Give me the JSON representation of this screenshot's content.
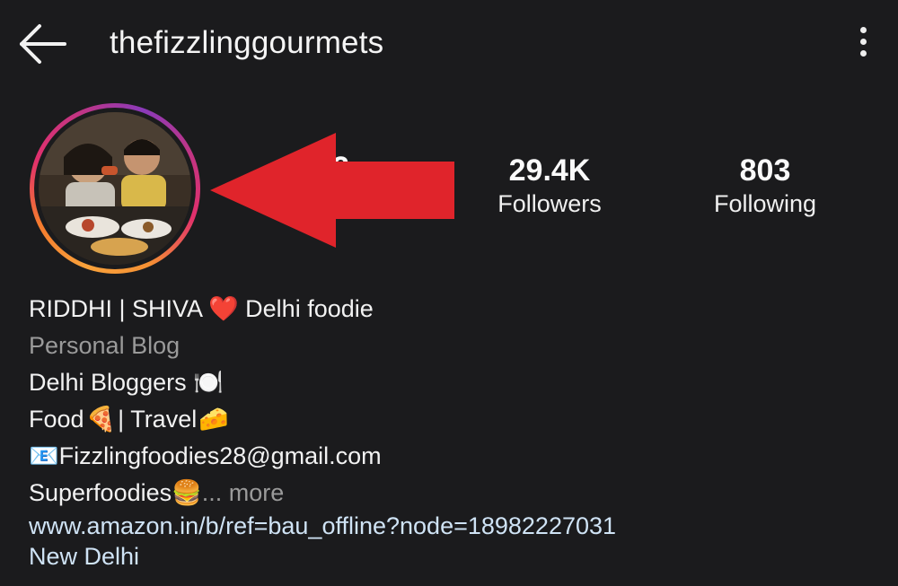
{
  "header": {
    "username": "thefizzlinggourmets"
  },
  "profile": {
    "posts_partial": "2",
    "stats": {
      "followers_count": "29.4K",
      "followers_label": "Followers",
      "following_count": "803",
      "following_label": "Following"
    },
    "bio": {
      "name_line": "RIDDHI | SHIVA ❤️ Delhi foodie",
      "category": "Personal Blog",
      "line1": "Delhi Bloggers 🍽️",
      "line2_a": "Food ",
      "line2_b": "🍕",
      "line2_c": "| Travel ",
      "line2_d": "🧀",
      "email": "📧Fizzlingfoodies28@gmail.com",
      "line4": "Superfoodies🍔",
      "more": "... more",
      "website": "www.amazon.in/b/ref=bau_offline?node=18982227031",
      "location": "New Delhi"
    }
  },
  "colors": {
    "background": "#1b1b1d",
    "arrow": "#e0242b",
    "link": "#cfe3f5"
  }
}
